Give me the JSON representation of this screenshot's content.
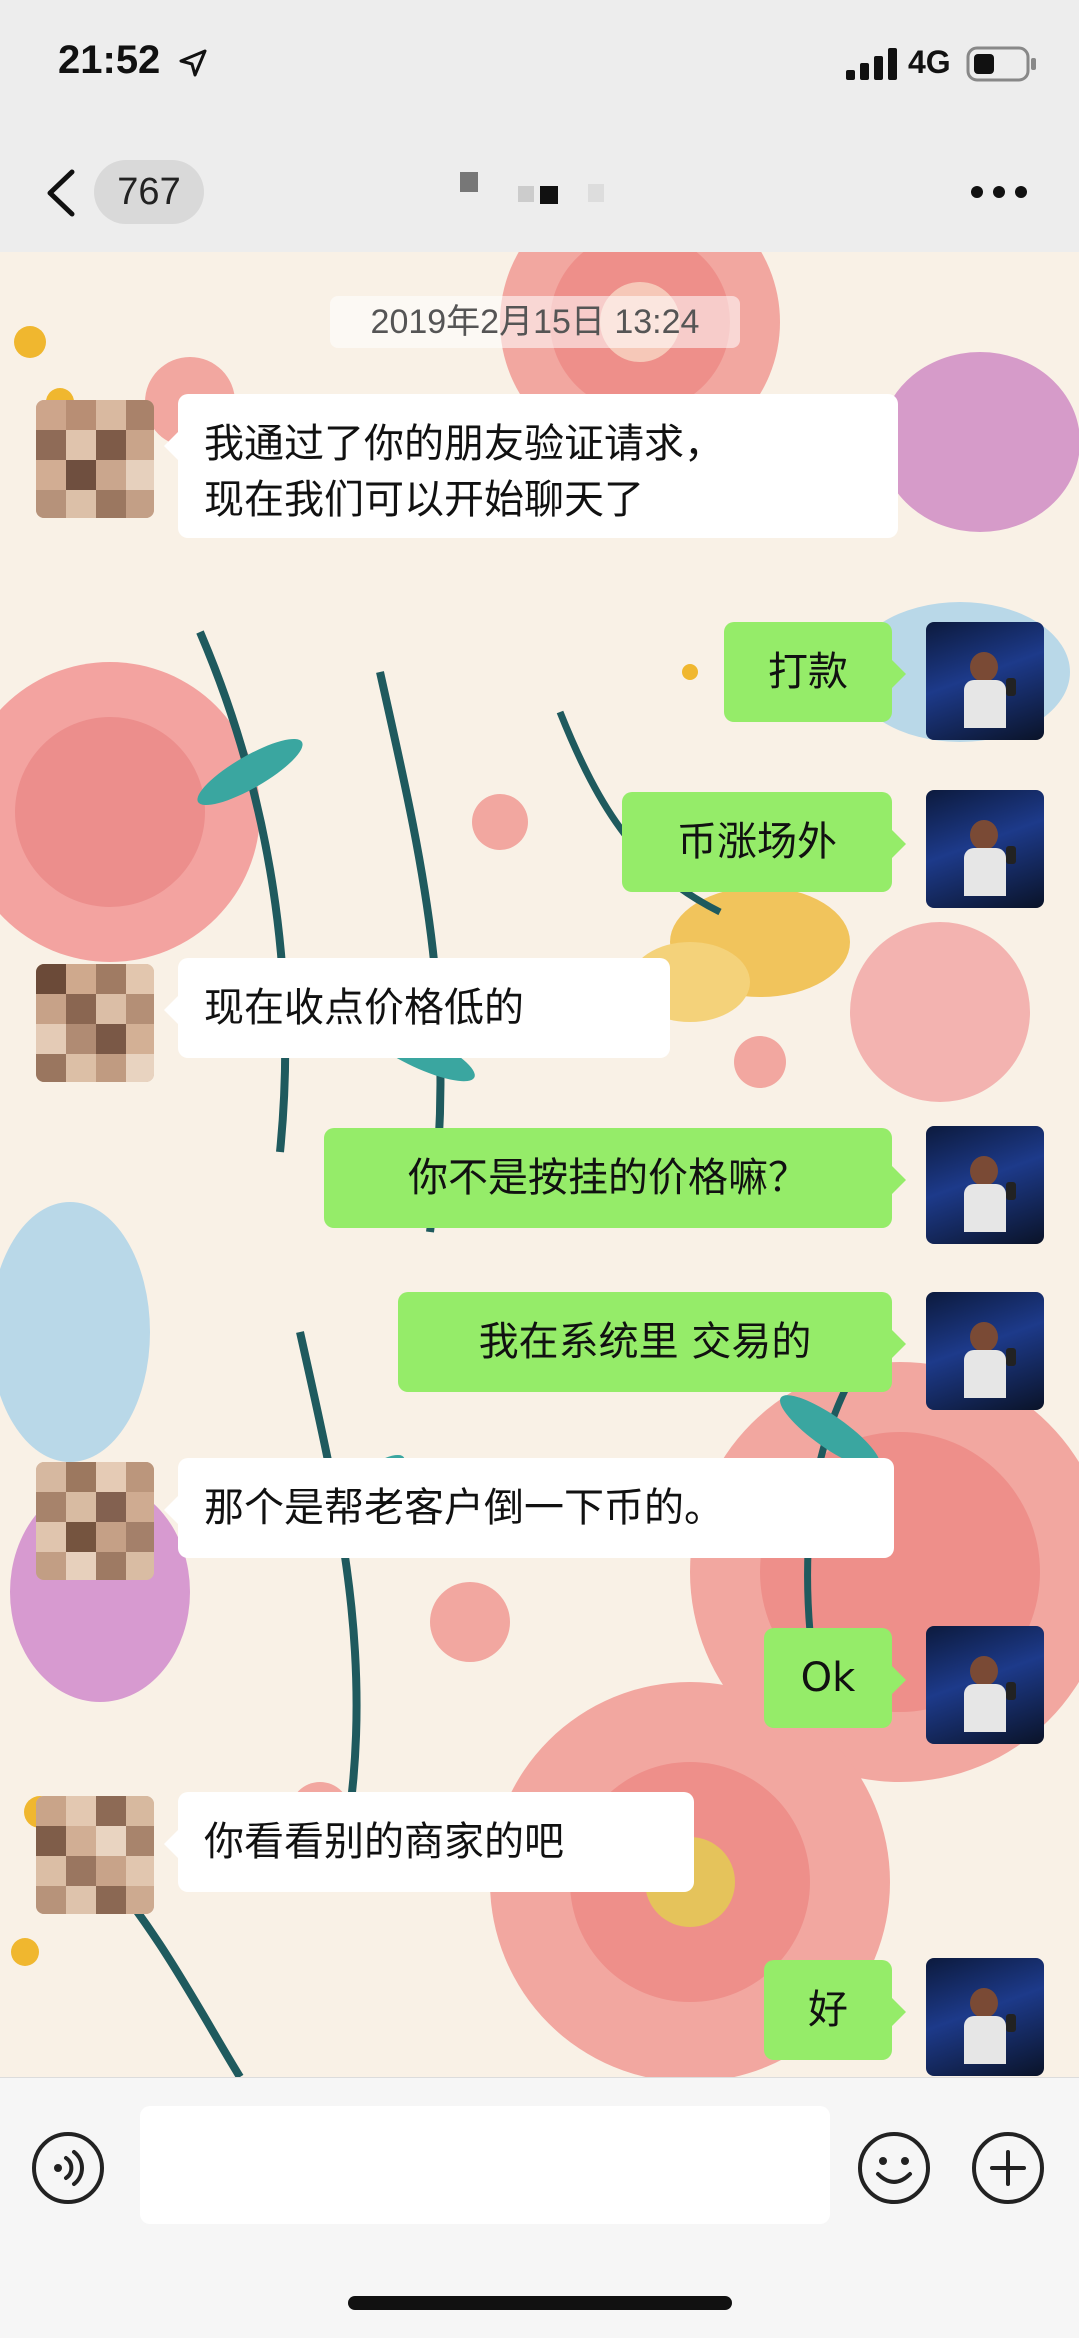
{
  "status_bar": {
    "time": "21:52",
    "network": "4G"
  },
  "nav": {
    "unread_count": "767"
  },
  "chat": {
    "timestamp": "2019年2月15日 13:24",
    "messages": [
      {
        "sender": "friend",
        "text": "我通过了你的朋友验证请求，\n现在我们可以开始聊天了"
      },
      {
        "sender": "me",
        "text": "打款"
      },
      {
        "sender": "me",
        "text": "币涨场外"
      },
      {
        "sender": "friend",
        "text": "现在收点价格低的"
      },
      {
        "sender": "me",
        "text": "你不是按挂的价格嘛？"
      },
      {
        "sender": "me",
        "text": "我在系统里  交易的"
      },
      {
        "sender": "friend",
        "text": "那个是帮老客户倒一下币的。"
      },
      {
        "sender": "me",
        "text": "Ok"
      },
      {
        "sender": "friend",
        "text": "你看看别的商家的吧"
      },
      {
        "sender": "me",
        "text": "好"
      }
    ]
  },
  "icons": {
    "back": "chevron-left-icon",
    "more": "more-dots-icon",
    "voice": "voice-icon",
    "emoji": "emoji-icon",
    "plus": "plus-icon",
    "location": "location-arrow-icon",
    "signal": "signal-icon",
    "battery": "battery-icon"
  },
  "colors": {
    "outgoing_bubble": "#95ec69",
    "incoming_bubble": "#ffffff",
    "bar_background": "#ededed"
  }
}
